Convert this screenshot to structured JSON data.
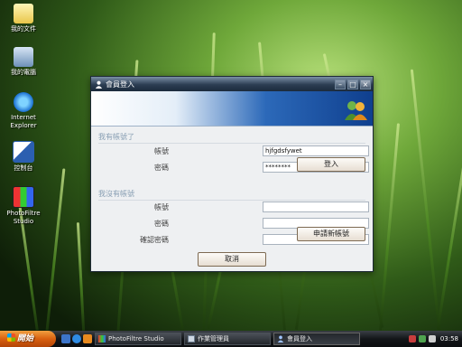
{
  "desktop": {
    "icons": [
      {
        "label": "我的文件"
      },
      {
        "label": "我的電腦"
      },
      {
        "label": "Internet Explorer"
      },
      {
        "label": "控制台"
      },
      {
        "label": "PhotoFiltre Studio"
      }
    ]
  },
  "dialog": {
    "title": "會員登入",
    "section_existing": "我有帳號了",
    "account_label": "帳號",
    "password_label": "密碼",
    "confirm_label": "確認密碼",
    "account_value": "hjfgdsfywet",
    "password_value": "********",
    "login_button": "登入",
    "section_new": "我沒有帳號",
    "new_account_value": "",
    "new_password_value": "",
    "new_confirm_value": "",
    "apply_button": "申請新帳號",
    "cancel_button": "取消"
  },
  "taskbar": {
    "start_label": "開始",
    "tasks": [
      {
        "label": "PhotoFiltre Studio"
      },
      {
        "label": "作業管理員"
      },
      {
        "label": "會員登入"
      }
    ],
    "clock": "03:58"
  }
}
